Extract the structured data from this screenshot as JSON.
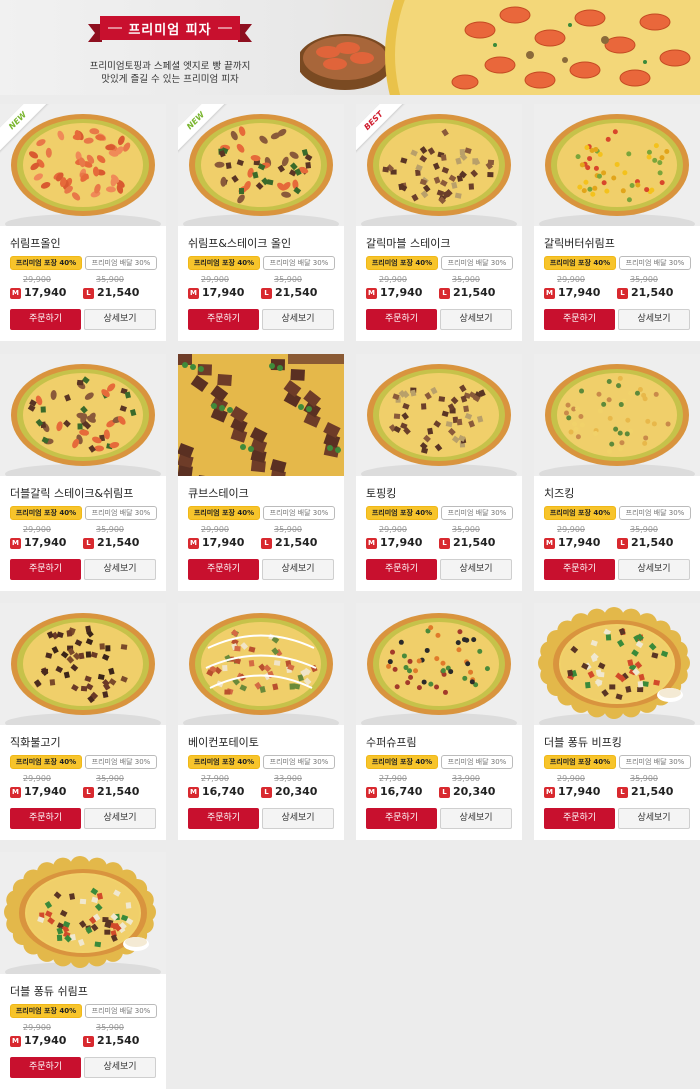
{
  "header": {
    "title": "프리미엄 피자",
    "subtitle_line1": "프리미엄토핑과 스페셜 엣지로 빵 끝까지",
    "subtitle_line2": "맛있게 즐길 수 있는 프리미엄 피자"
  },
  "labels": {
    "pickup_tag": "프리미엄 포장 40%",
    "delivery_tag": "프리미엄 배달 30%",
    "size_m": "M",
    "size_l": "L",
    "order_button": "주문하기",
    "detail_button": "상세보기"
  },
  "colors": {
    "accent_red": "#c8102e",
    "pickup_yellow": "#f7c42b",
    "new_green": "#79b52e",
    "best_red": "#d01d2f"
  },
  "products": [
    {
      "name": "쉬림프올인",
      "badge": "NEW",
      "orig_m": "29,900",
      "orig_l": "35,900",
      "price_m": "17,940",
      "price_l": "21,540",
      "topping": "shrimp"
    },
    {
      "name": "쉬림프&스테이크 올인",
      "badge": "NEW",
      "orig_m": "29,900",
      "orig_l": "35,900",
      "price_m": "17,940",
      "price_l": "21,540",
      "topping": "mixed"
    },
    {
      "name": "갈릭마블 스테이크",
      "badge": "BEST",
      "orig_m": "29,900",
      "orig_l": "35,900",
      "price_m": "17,940",
      "price_l": "21,540",
      "topping": "steak"
    },
    {
      "name": "갈릭버터쉬림프",
      "badge": "",
      "orig_m": "29,900",
      "orig_l": "35,900",
      "price_m": "17,940",
      "price_l": "21,540",
      "topping": "corn"
    },
    {
      "name": "더블갈릭 스테이크&쉬림프",
      "badge": "",
      "orig_m": "29,900",
      "orig_l": "35,900",
      "price_m": "17,940",
      "price_l": "21,540",
      "topping": "mixed"
    },
    {
      "name": "큐브스테이크",
      "badge": "",
      "orig_m": "29,900",
      "orig_l": "35,900",
      "price_m": "17,940",
      "price_l": "21,540",
      "topping": "closeup"
    },
    {
      "name": "토핑킹",
      "badge": "",
      "orig_m": "29,900",
      "orig_l": "35,900",
      "price_m": "17,940",
      "price_l": "21,540",
      "topping": "steak"
    },
    {
      "name": "치즈킹",
      "badge": "",
      "orig_m": "29,900",
      "orig_l": "35,900",
      "price_m": "17,940",
      "price_l": "21,540",
      "topping": "cheese"
    },
    {
      "name": "직화불고기",
      "badge": "",
      "orig_m": "29,900",
      "orig_l": "35,900",
      "price_m": "17,940",
      "price_l": "21,540",
      "topping": "bulgogi"
    },
    {
      "name": "베이컨포테이토",
      "badge": "",
      "orig_m": "27,900",
      "orig_l": "33,900",
      "price_m": "16,740",
      "price_l": "20,340",
      "topping": "bacon"
    },
    {
      "name": "수퍼슈프림",
      "badge": "",
      "orig_m": "27,900",
      "orig_l": "33,900",
      "price_m": "16,740",
      "price_l": "20,340",
      "topping": "supreme"
    },
    {
      "name": "더블 퐁듀 비프킹",
      "badge": "",
      "orig_m": "29,900",
      "orig_l": "35,900",
      "price_m": "17,940",
      "price_l": "21,540",
      "topping": "fondue"
    },
    {
      "name": "더블 퐁듀 쉬림프",
      "badge": "",
      "orig_m": "29,900",
      "orig_l": "35,900",
      "price_m": "17,940",
      "price_l": "21,540",
      "topping": "fondue"
    }
  ]
}
